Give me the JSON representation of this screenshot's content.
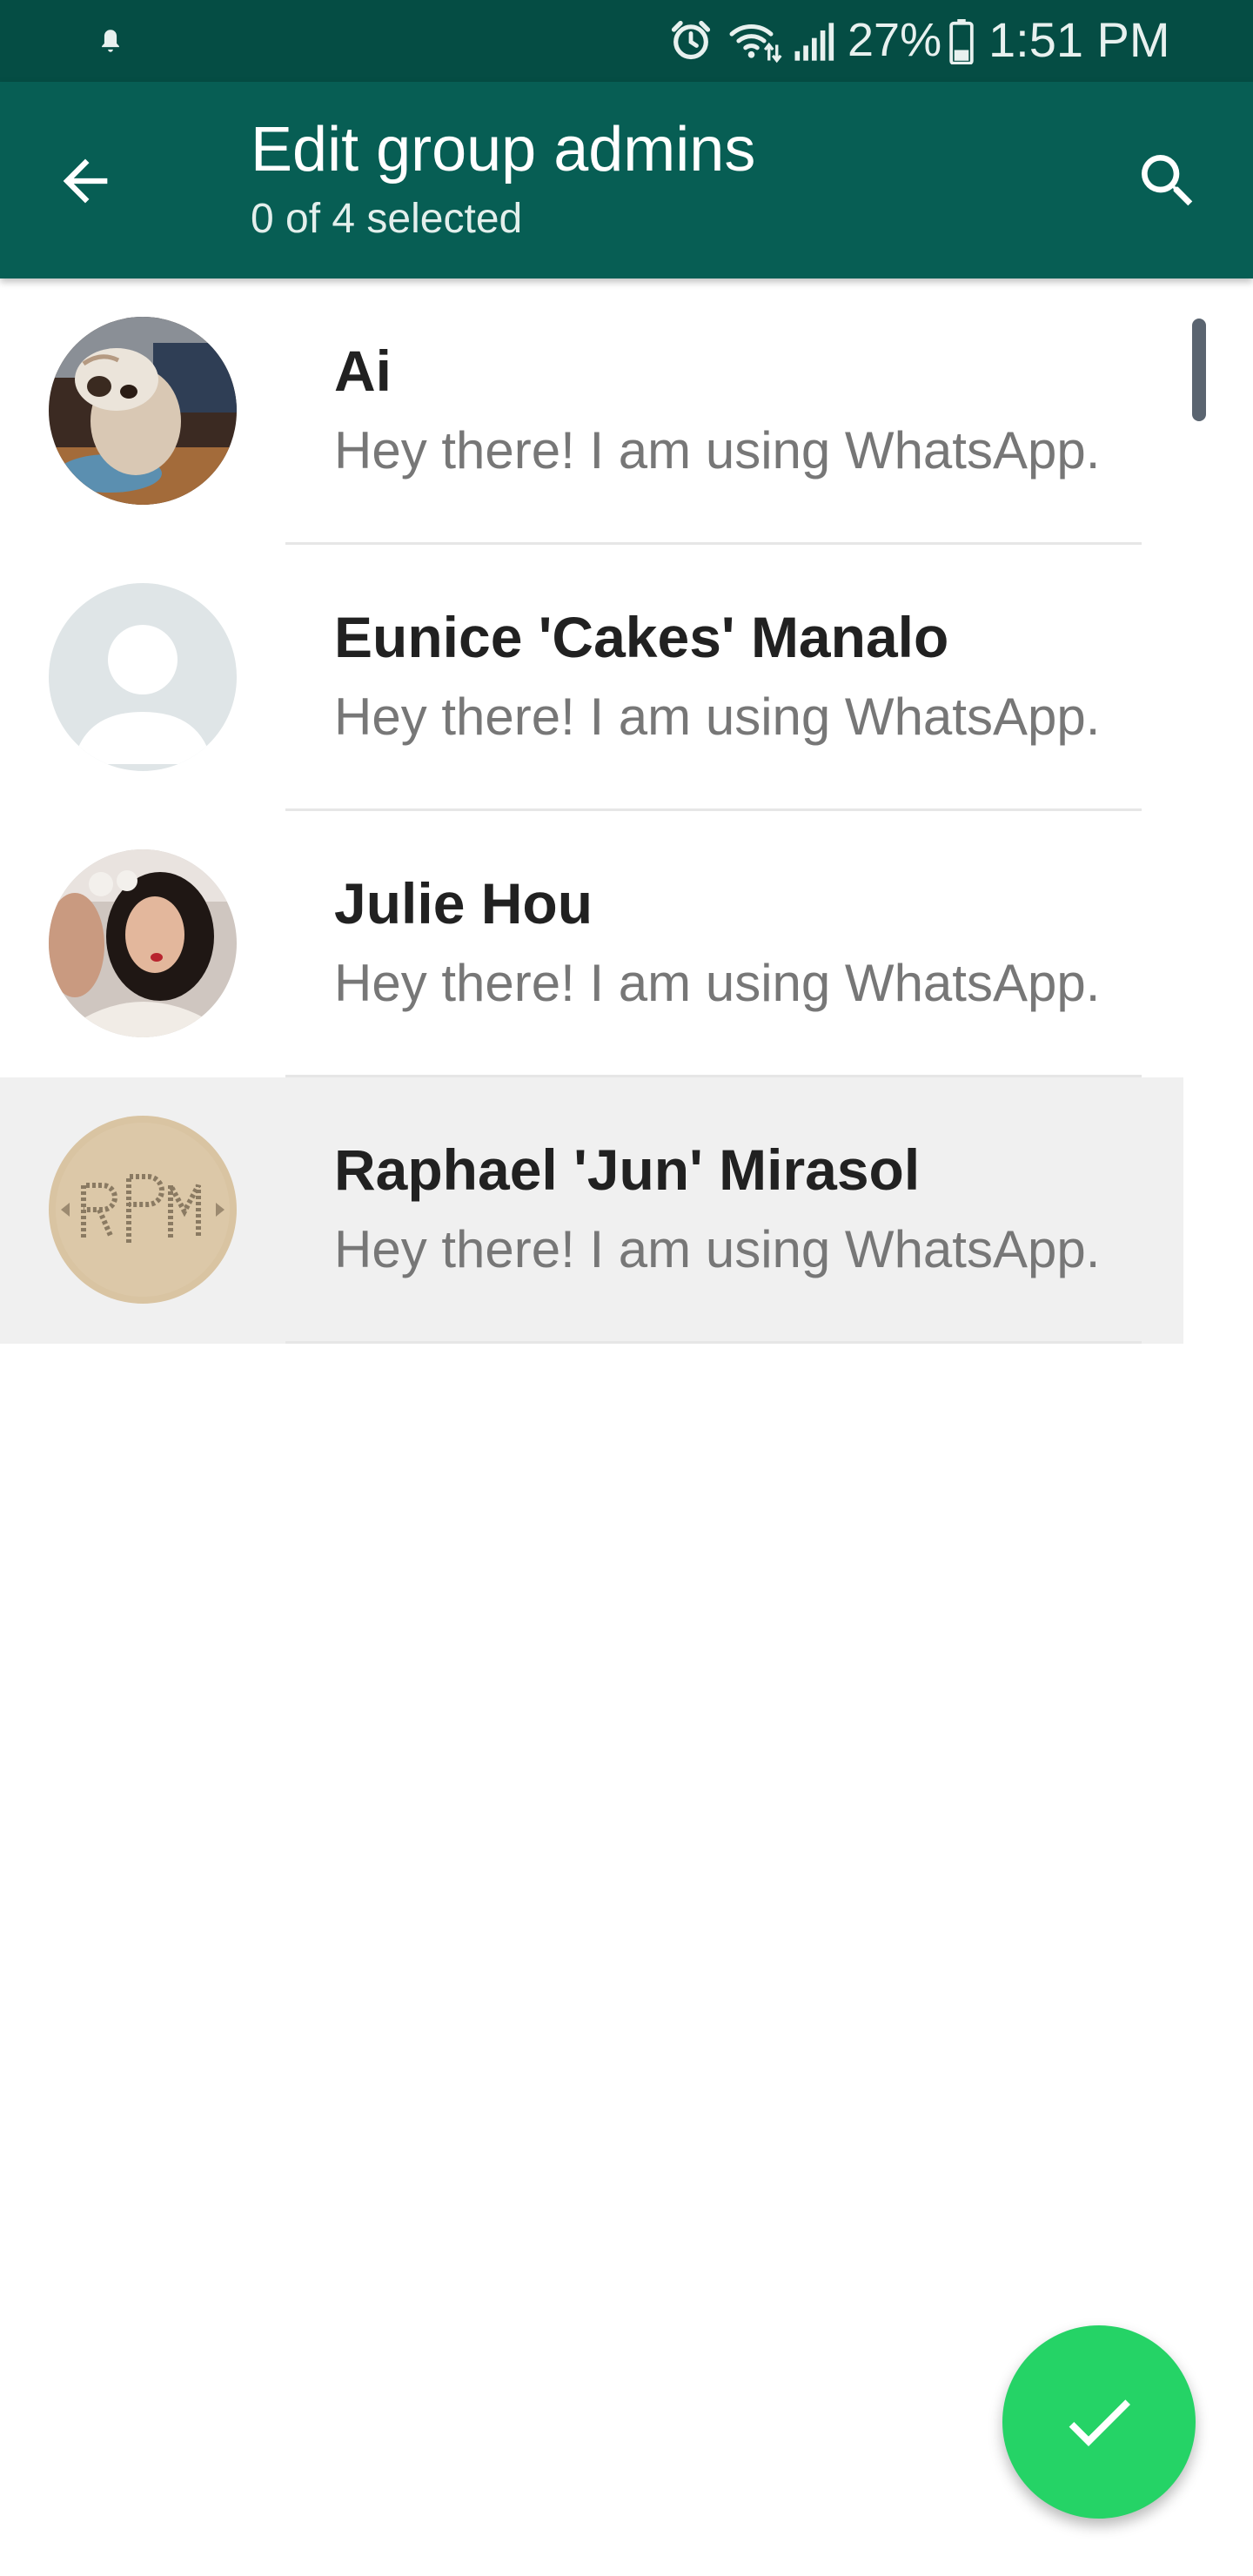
{
  "status_bar": {
    "battery_percent": "27%",
    "time": "1:51 PM",
    "icons": [
      "notification-bell-icon",
      "alarm-icon",
      "wifi-icon",
      "signal-icon",
      "battery-icon"
    ]
  },
  "app_bar": {
    "title": "Edit group admins",
    "subtitle": "0 of 4 selected",
    "back_icon": "arrow-back-icon",
    "search_icon": "search-icon"
  },
  "contacts": [
    {
      "name": "Ai",
      "status": "Hey there! I am using WhatsApp.",
      "avatar": "bulldog-photo"
    },
    {
      "name": "Eunice 'Cakes' Manalo",
      "status": "Hey there! I am using WhatsApp.",
      "avatar": "default-person"
    },
    {
      "name": "Julie Hou",
      "status": "Hey there! I am using WhatsApp.",
      "avatar": "selfie-photo"
    },
    {
      "name": "Raphael 'Jun' Mirasol",
      "status": "Hey there! I am using WhatsApp.",
      "avatar": "monogram-photo"
    }
  ],
  "fab": {
    "icon": "check-icon"
  },
  "colors": {
    "status_bar": "#054d44",
    "app_bar": "#075e54",
    "fab": "#25d366",
    "pressed_row": "#f0f0f0"
  }
}
